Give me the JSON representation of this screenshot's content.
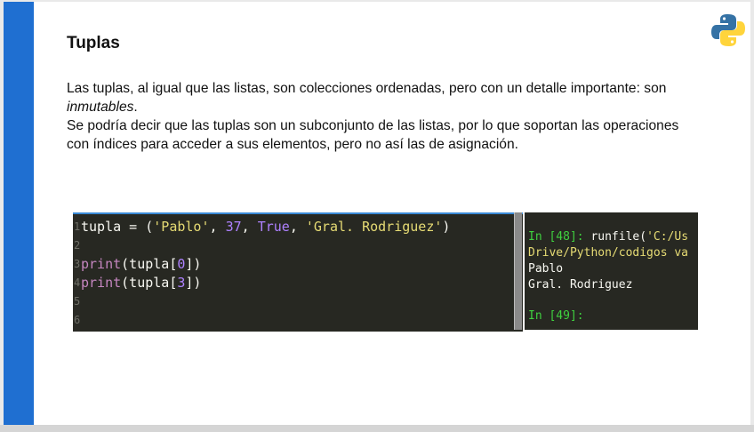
{
  "slide": {
    "title": "Tuplas",
    "para1_pre": "Las tuplas, al igual que las listas, son colecciones ordenadas, pero con un detalle importante: son ",
    "para1_em": "inmutables",
    "para1_post": ".",
    "para2": "Se podría decir que las tuplas son un subconjunto de las listas, por lo que soportan las operaciones con índices para acceder a sus elementos, pero no así las de asignación."
  },
  "logo": {
    "icon": "python-logo-icon",
    "colors": [
      "#3572a5",
      "#ffd43b"
    ]
  },
  "editor": {
    "line_numbers": [
      "1",
      "2",
      "3",
      "4",
      "5",
      "6"
    ],
    "line1": {
      "var": "tupla = (",
      "s1": "'Pablo'",
      "c1": ", ",
      "n1": "37",
      "c2": ", ",
      "b1": "True",
      "c3": ", ",
      "s2": "'Gral. Rodriguez'",
      "end": ")"
    },
    "line3": {
      "fn": "print",
      "a": "(tupla[",
      "n": "0",
      "b": "])"
    },
    "line4": {
      "fn": "print",
      "a": "(tupla[",
      "n": "3",
      "b": "])"
    }
  },
  "console": {
    "prompt1": "In [48]: ",
    "cmd1_a": "runfile(",
    "cmd1_b": "'C:/Us",
    "cmd1_cont": "Drive/Python/codigos va",
    "out1": "Pablo",
    "out2": "Gral. Rodriguez",
    "prompt2": "In [49]:"
  },
  "colors": {
    "accent_bar": "#1f6fd1",
    "editor_bg": "#272822",
    "string": "#e6db74",
    "number": "#ae81ff",
    "prompt": "#3fd13f"
  }
}
